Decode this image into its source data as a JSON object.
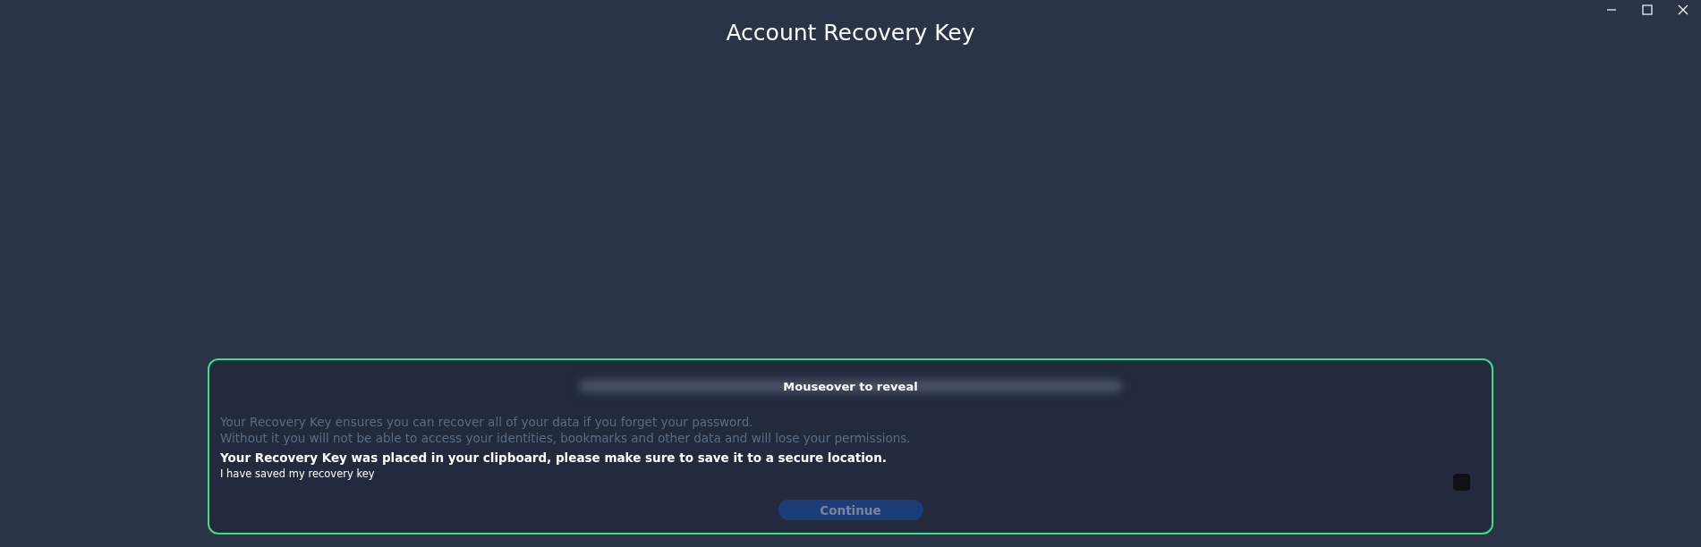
{
  "window_controls": [
    {
      "kind": "minimize"
    },
    {
      "kind": "maximize"
    },
    {
      "kind": "close"
    }
  ],
  "title": "Account Recovery Key",
  "recovery_key": {
    "hint": "Mouseover to reveal"
  },
  "description": [
    "Your Recovery Key ensures you can recover all of your data if you forget your password.",
    "Without it you will not be able to access your identities, bookmarks and other data and will lose your permissions."
  ],
  "notice": "Your Recovery Key was placed in your clipboard, please make sure to save it to a secure location.",
  "confirm": {
    "label": "I have saved my recovery key",
    "checked": false
  },
  "continue_button": {
    "label": "Continue",
    "disabled": true
  }
}
